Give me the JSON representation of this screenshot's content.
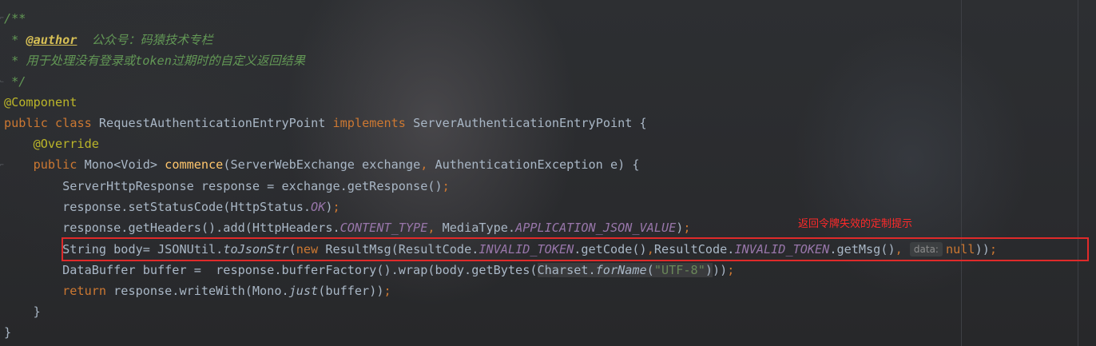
{
  "code": {
    "l1": "/**",
    "l2_prefix": " * ",
    "l2_tag": "@author",
    "l2_text": "  公众号：码猿技术专栏",
    "l3": " * 用于处理没有登录或token过期时的自定义返回结果",
    "l4": " */",
    "l5": "@Component",
    "l6_public": "public",
    "l6_class": "class",
    "l6_name": "RequestAuthenticationEntryPoint",
    "l6_implements": "implements",
    "l6_iface": "ServerAuthenticationEntryPoint {",
    "l7": "    @Override",
    "l8_public": "    public",
    "l8_type": " Mono<Void> ",
    "l8_method": "commence",
    "l8_params": "(ServerWebExchange exchange",
    "l8_comma": ",",
    "l8_params2": " AuthenticationException e) {",
    "l9_a": "        ServerHttpResponse response = exchange.getResponse()",
    "l9_semi": ";",
    "l10_a": "        response.setStatusCode(HttpStatus.",
    "l10_ok": "OK",
    "l10_b": ")",
    "l10_semi": ";",
    "l11_a": "        response.getHeaders().add(HttpHeaders.",
    "l11_ct": "CONTENT_TYPE",
    "l11_comma": ",",
    "l11_b": " MediaType.",
    "l11_json": "APPLICATION_JSON_VALUE",
    "l11_c": ")",
    "l11_semi": ";",
    "l12_a": "        String body= JSONUtil.",
    "l12_tojson": "toJsonStr",
    "l12_b": "(",
    "l12_new": "new",
    "l12_c": " ResultMsg(ResultCode.",
    "l12_tok1": "INVALID_TOKEN",
    "l12_d": ".getCode()",
    "l12_comma1": ",",
    "l12_e": "ResultCode.",
    "l12_tok2": "INVALID_TOKEN",
    "l12_f": ".getMsg()",
    "l12_comma2": ", ",
    "l12_hint": "data:",
    "l12_null": "null",
    "l12_g": "))",
    "l12_semi": ";",
    "l13_a": "        DataBuffer buffer =  response.bufferFactory().wrap(body.getBytes(",
    "l13_charset": "Charset.",
    "l13_forname": "forName",
    "l13_paren": "(",
    "l13_str": "\"UTF-8\"",
    "l13_close": ")",
    "l13_b": "))",
    "l13_semi": ";",
    "l14_return": "        return",
    "l14_a": " response.writeWith(Mono.",
    "l14_just": "just",
    "l14_b": "(buffer))",
    "l14_semi": ";",
    "l15": "    }",
    "l16": "}"
  },
  "annotation": {
    "note": "返回令牌失效的定制提示",
    "color": "#ff2a2a"
  },
  "colors": {
    "keyword": "#cc7832",
    "comment": "#629755",
    "annotation": "#bbb529",
    "method_decl": "#ffc66d",
    "static_field": "#9876aa",
    "string": "#6a8759",
    "default_text": "#a9b7c6"
  }
}
